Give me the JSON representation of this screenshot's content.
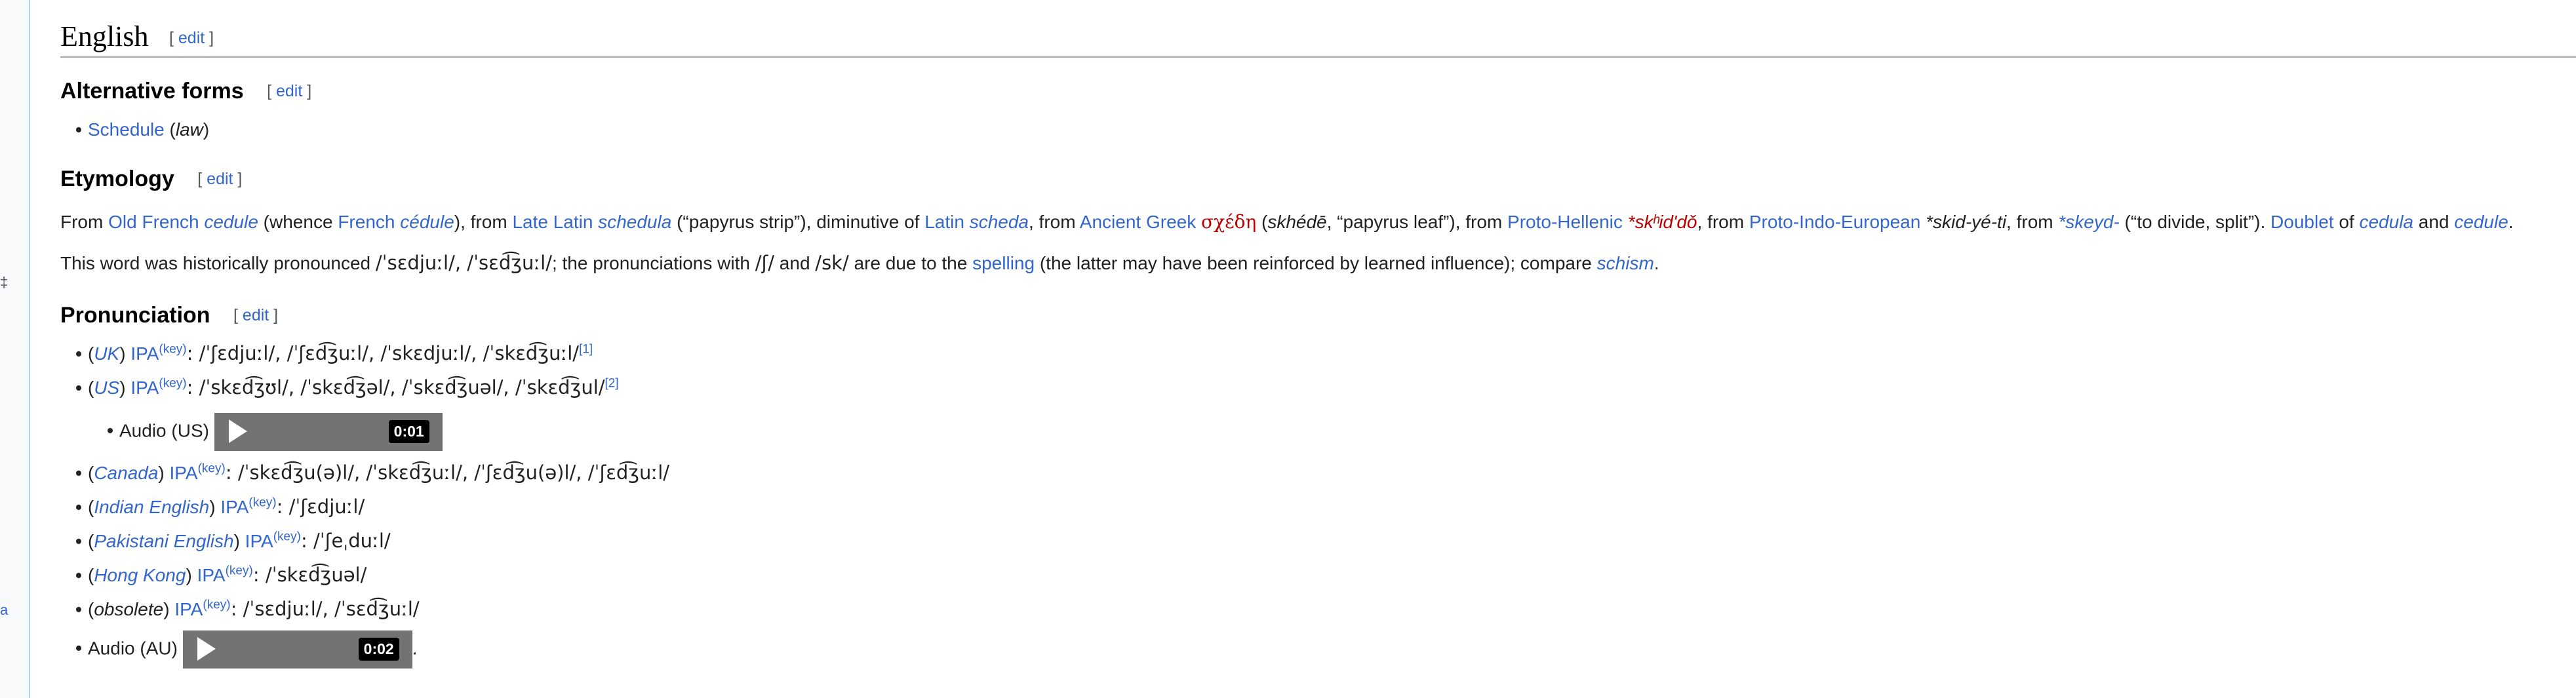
{
  "edit_link": {
    "open": "[ ",
    "label": "edit",
    "close": " ]"
  },
  "language": "English",
  "alternative_forms": {
    "heading": "Alternative forms",
    "item_word": "Schedule",
    "item_qual_open": " (",
    "item_qual": "law",
    "item_qual_close": ")"
  },
  "etymology": {
    "heading": "Etymology",
    "p1": {
      "t0": "From ",
      "old_french": "Old French",
      "cedule": "cedule",
      "t1": " (whence ",
      "french": "French",
      "cedule_fr": "cédule",
      "t2": "), from ",
      "late_latin": "Late Latin",
      "schedula": "schedula",
      "t3": " (“papyrus strip”), diminutive of ",
      "latin": "Latin",
      "scheda": "scheda",
      "t4": ", from ",
      "ancient_greek": "Ancient Greek",
      "greek_word": "σχέδη",
      "t5": " (",
      "greek_translit": "skhédē",
      "t6": ", “papyrus leaf”), from ",
      "proto_hellenic": "Proto-Hellenic",
      "ph_word": "*skʰidʹdǒ",
      "t7": ", from ",
      "pie": "Proto-Indo-European",
      "pie_word": "*skid-yé-ti",
      "t8": ", from ",
      "skeyd": "*skeyd-",
      "t9": " (“to divide, split”). ",
      "doublet": "Doublet",
      "t10": " of ",
      "cedula": "cedula",
      "t11": " and ",
      "cedule2": "cedule",
      "t12": "."
    },
    "p2": {
      "t0": "This word was historically pronounced ",
      "ipa1": "/ˈsɛdjuːl/, /ˈsɛd͡ʒuːl/",
      "t1": "; the pronunciations with ",
      "ipa2": "/ʃ/",
      "t2": " and ",
      "ipa3": "/sk/",
      "t3": " are due to the ",
      "spelling": "spelling",
      "t4": " (the latter may have been reinforced by learned influence); compare ",
      "schism": "schism",
      "t5": "."
    }
  },
  "pronunciation": {
    "heading": "Pronunciation",
    "ipa_label": "IPA",
    "key_label": "(key)",
    "items": [
      {
        "region": "UK",
        "ipa": ": /ˈʃɛdjuːl/, /ˈʃɛd͡ʒuːl/, /ˈskɛdjuːl/, /ˈskɛd͡ʒuːl/",
        "ref": "[1]"
      },
      {
        "region": "US",
        "ipa": ": /ˈskɛd͡ʒʊl/, /ˈskɛd͡ʒəl/, /ˈskɛd͡ʒuəl/, /ˈskɛd͡ʒul/",
        "ref": "[2]"
      },
      {
        "region": "Canada",
        "ipa": ": /ˈskɛd͡ʒu(ə)l/, /ˈskɛd͡ʒuːl/, /ˈʃɛd͡ʒu(ə)l/, /ˈʃɛd͡ʒuːl/"
      },
      {
        "region": "Indian English",
        "ipa": ": /ˈʃɛdjuːl/"
      },
      {
        "region": "Pakistani English",
        "ipa": ": /ˈʃeˌduːl/"
      },
      {
        "region": "Hong Kong",
        "ipa": ": /ˈskɛd͡ʒuəl/"
      },
      {
        "region": "obsolete",
        "ipa": ": /ˈsɛdjuːl/, /ˈsɛd͡ʒuːl/"
      }
    ],
    "audio_us": {
      "label": "Audio (US)",
      "time": "0:01"
    },
    "audio_au": {
      "label": "Audio (AU)",
      "time": "0:02",
      "trail": "."
    }
  }
}
